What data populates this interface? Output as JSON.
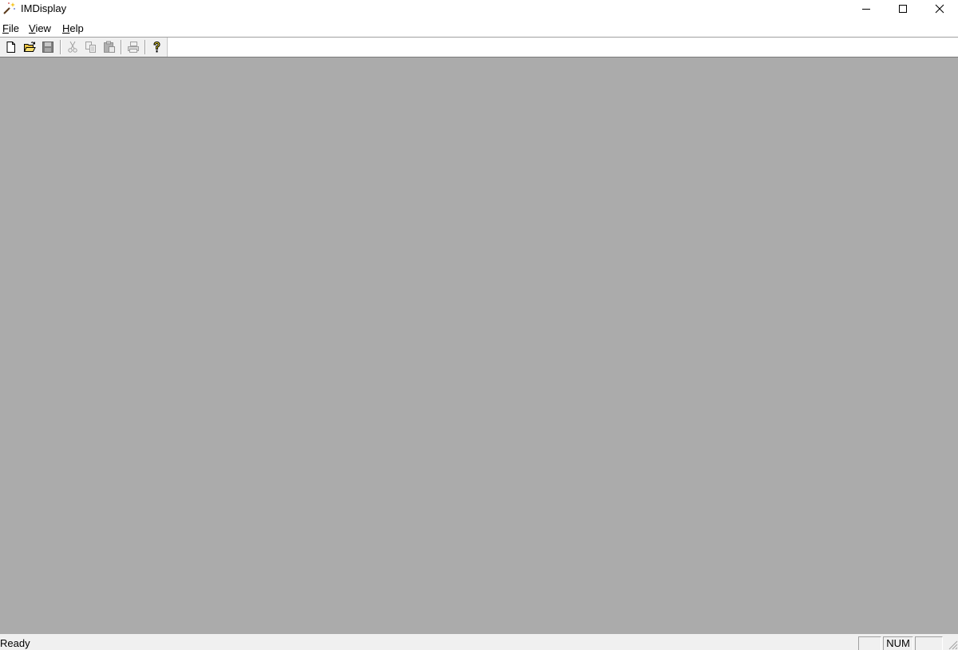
{
  "window": {
    "title": "IMDisplay",
    "app_icon": "magic-wand-icon"
  },
  "menu": {
    "items": [
      {
        "label": "File",
        "mnemonic": "F",
        "rest": "ile"
      },
      {
        "label": "View",
        "mnemonic": "V",
        "rest": "iew"
      },
      {
        "label": "Help",
        "mnemonic": "H",
        "rest": "elp"
      }
    ]
  },
  "toolbar": {
    "buttons": [
      {
        "id": "new",
        "icon": "new-document-icon",
        "enabled": true
      },
      {
        "id": "open",
        "icon": "open-folder-icon",
        "enabled": true
      },
      {
        "id": "save",
        "icon": "save-disk-icon",
        "enabled": false
      },
      {
        "id": "cut",
        "icon": "scissors-icon",
        "enabled": false
      },
      {
        "id": "copy",
        "icon": "copy-icon",
        "enabled": false
      },
      {
        "id": "paste",
        "icon": "paste-icon",
        "enabled": false
      },
      {
        "id": "print",
        "icon": "printer-icon",
        "enabled": false
      },
      {
        "id": "help",
        "icon": "help-question-icon",
        "enabled": true
      }
    ]
  },
  "colors": {
    "client_background": "#ababab",
    "chrome_background": "#f0f0f0"
  },
  "statusbar": {
    "text": "Ready",
    "panes": [
      "",
      "NUM",
      ""
    ]
  }
}
